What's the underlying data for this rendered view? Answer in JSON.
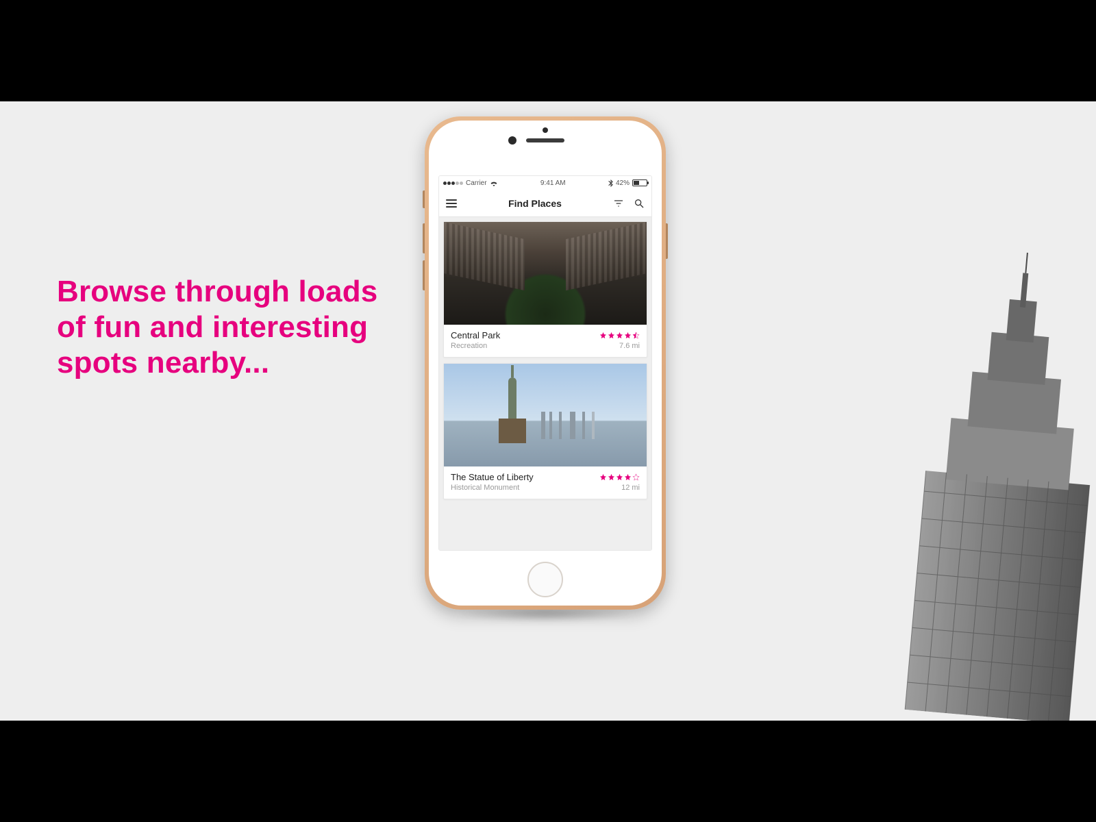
{
  "headline": "Browse through loads of fun and interesting spots nearby...",
  "status": {
    "carrier": "Carrier",
    "time": "9:41 AM",
    "battery": "42%"
  },
  "nav": {
    "title": "Find Places"
  },
  "cards": [
    {
      "name": "Central Park",
      "category": "Recreation",
      "distance": "7.6 mi",
      "rating": 4.5
    },
    {
      "name": "The Statue of Liberty",
      "category": "Historical Monument",
      "distance": "12 mi",
      "rating": 4.0
    }
  ]
}
